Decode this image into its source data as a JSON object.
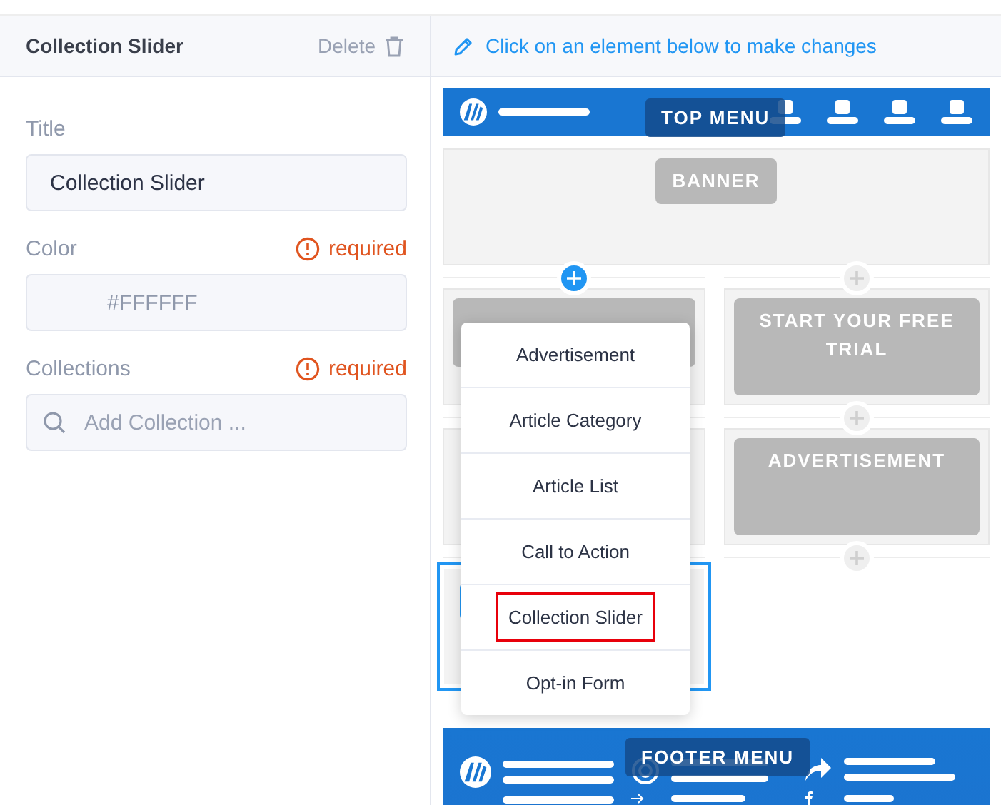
{
  "sidebar": {
    "title": "Collection Slider",
    "delete_label": "Delete",
    "fields": [
      {
        "label": "Title",
        "kind": "text",
        "value": "Collection Slider",
        "required": false
      },
      {
        "label": "Color",
        "kind": "color",
        "value": "#FFFFFF",
        "required": true,
        "required_label": "required"
      },
      {
        "label": "Collections",
        "kind": "search",
        "placeholder": "Add Collection ...",
        "required": true,
        "required_label": "required"
      }
    ]
  },
  "editor": {
    "hint": "Click on an element below to make changes",
    "top_menu_label": "TOP MENU",
    "banner_label": "BANNER",
    "banner_adders": [
      {
        "kind": "add",
        "active": true
      },
      {
        "kind": "add",
        "active": false
      }
    ],
    "rows": [
      {
        "cells": [
          {
            "kind": "pill",
            "selected": false
          },
          {
            "kind": "label",
            "label": "START YOUR FREE TRIAL",
            "selected": false
          }
        ],
        "adders": [
          {
            "kind": "none"
          },
          {
            "kind": "add",
            "active": false
          }
        ]
      },
      {
        "cells": [
          {
            "kind": "empty",
            "selected": false
          },
          {
            "kind": "label",
            "label": "ADVERTISEMENT",
            "selected": false
          }
        ],
        "adders": [
          {
            "kind": "none"
          },
          {
            "kind": "add",
            "active": false
          }
        ]
      },
      {
        "cells": [
          {
            "kind": "button",
            "selected": true
          }
        ],
        "adders": []
      }
    ],
    "add_menu": {
      "items": [
        {
          "label": "Advertisement",
          "selected": false
        },
        {
          "label": "Article Category",
          "selected": false
        },
        {
          "label": "Article List",
          "selected": false
        },
        {
          "label": "Call to Action",
          "selected": false
        },
        {
          "label": "Collection Slider",
          "selected": true
        },
        {
          "label": "Opt-in Form",
          "selected": false
        }
      ]
    },
    "footer_label": "FOOTER MENU"
  }
}
